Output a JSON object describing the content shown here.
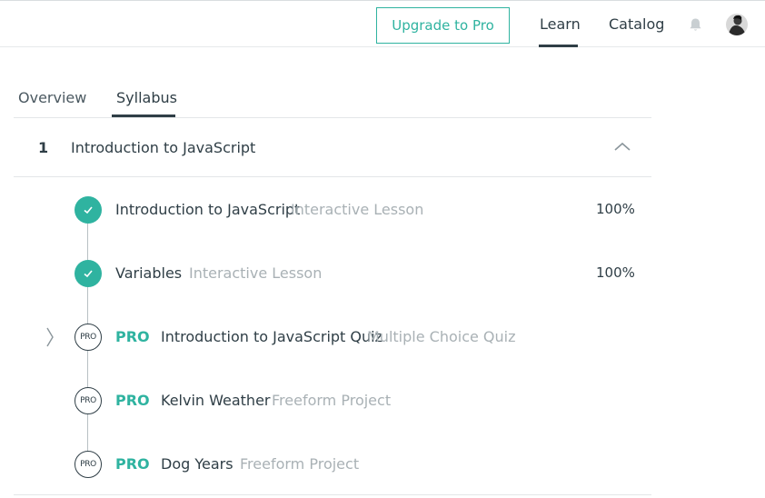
{
  "header": {
    "upgrade_label": "Upgrade to Pro",
    "nav": {
      "learn": "Learn",
      "catalog": "Catalog"
    },
    "icons": {
      "bell": "bell-icon",
      "avatar": "user-avatar"
    },
    "accent_color": "#2fb3a0"
  },
  "tabs": {
    "overview": "Overview",
    "syllabus": "Syllabus",
    "active": "Syllabus"
  },
  "module": {
    "number": "1",
    "title": "Introduction to JavaScript",
    "expanded": true
  },
  "lessons": [
    {
      "title": "Introduction to JavaScript",
      "type": "Interactive Lesson",
      "progress": "100%",
      "completed": true,
      "pro": false
    },
    {
      "title": "Variables",
      "type": "Interactive Lesson",
      "progress": "100%",
      "completed": true,
      "pro": false
    },
    {
      "pro_label": "PRO",
      "badge": "PRO",
      "title": "Introduction to JavaScript Quiz",
      "type": "Multiple Choice Quiz",
      "completed": false,
      "pro": true
    },
    {
      "pro_label": "PRO",
      "badge": "PRO",
      "title": "Kelvin Weather",
      "type": "Freeform Project",
      "completed": false,
      "pro": true
    },
    {
      "pro_label": "PRO",
      "badge": "PRO",
      "title": "Dog Years",
      "type": "Freeform Project",
      "completed": false,
      "pro": true
    }
  ]
}
